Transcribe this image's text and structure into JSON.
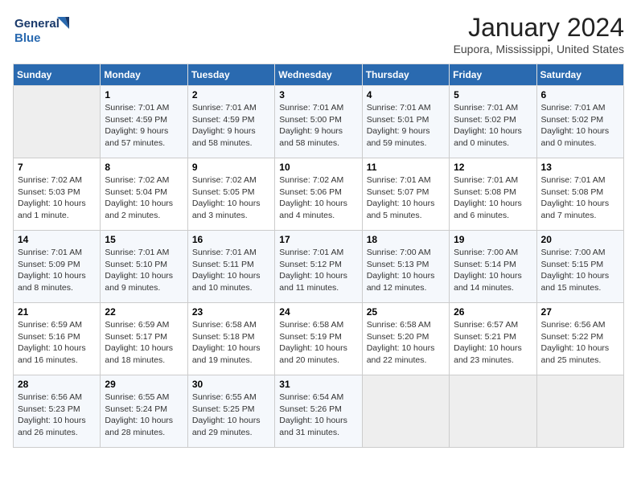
{
  "header": {
    "logo_line1": "General",
    "logo_line2": "Blue",
    "title": "January 2024",
    "subtitle": "Eupora, Mississippi, United States"
  },
  "days_of_week": [
    "Sunday",
    "Monday",
    "Tuesday",
    "Wednesday",
    "Thursday",
    "Friday",
    "Saturday"
  ],
  "weeks": [
    [
      {
        "day": null
      },
      {
        "day": "1",
        "sunrise": "7:01 AM",
        "sunset": "4:59 PM",
        "daylight": "9 hours and 57 minutes."
      },
      {
        "day": "2",
        "sunrise": "7:01 AM",
        "sunset": "4:59 PM",
        "daylight": "9 hours and 58 minutes."
      },
      {
        "day": "3",
        "sunrise": "7:01 AM",
        "sunset": "5:00 PM",
        "daylight": "9 hours and 58 minutes."
      },
      {
        "day": "4",
        "sunrise": "7:01 AM",
        "sunset": "5:01 PM",
        "daylight": "9 hours and 59 minutes."
      },
      {
        "day": "5",
        "sunrise": "7:01 AM",
        "sunset": "5:02 PM",
        "daylight": "10 hours and 0 minutes."
      },
      {
        "day": "6",
        "sunrise": "7:01 AM",
        "sunset": "5:02 PM",
        "daylight": "10 hours and 0 minutes."
      }
    ],
    [
      {
        "day": "7",
        "sunrise": "7:02 AM",
        "sunset": "5:03 PM",
        "daylight": "10 hours and 1 minute."
      },
      {
        "day": "8",
        "sunrise": "7:02 AM",
        "sunset": "5:04 PM",
        "daylight": "10 hours and 2 minutes."
      },
      {
        "day": "9",
        "sunrise": "7:02 AM",
        "sunset": "5:05 PM",
        "daylight": "10 hours and 3 minutes."
      },
      {
        "day": "10",
        "sunrise": "7:02 AM",
        "sunset": "5:06 PM",
        "daylight": "10 hours and 4 minutes."
      },
      {
        "day": "11",
        "sunrise": "7:01 AM",
        "sunset": "5:07 PM",
        "daylight": "10 hours and 5 minutes."
      },
      {
        "day": "12",
        "sunrise": "7:01 AM",
        "sunset": "5:08 PM",
        "daylight": "10 hours and 6 minutes."
      },
      {
        "day": "13",
        "sunrise": "7:01 AM",
        "sunset": "5:08 PM",
        "daylight": "10 hours and 7 minutes."
      }
    ],
    [
      {
        "day": "14",
        "sunrise": "7:01 AM",
        "sunset": "5:09 PM",
        "daylight": "10 hours and 8 minutes."
      },
      {
        "day": "15",
        "sunrise": "7:01 AM",
        "sunset": "5:10 PM",
        "daylight": "10 hours and 9 minutes."
      },
      {
        "day": "16",
        "sunrise": "7:01 AM",
        "sunset": "5:11 PM",
        "daylight": "10 hours and 10 minutes."
      },
      {
        "day": "17",
        "sunrise": "7:01 AM",
        "sunset": "5:12 PM",
        "daylight": "10 hours and 11 minutes."
      },
      {
        "day": "18",
        "sunrise": "7:00 AM",
        "sunset": "5:13 PM",
        "daylight": "10 hours and 12 minutes."
      },
      {
        "day": "19",
        "sunrise": "7:00 AM",
        "sunset": "5:14 PM",
        "daylight": "10 hours and 14 minutes."
      },
      {
        "day": "20",
        "sunrise": "7:00 AM",
        "sunset": "5:15 PM",
        "daylight": "10 hours and 15 minutes."
      }
    ],
    [
      {
        "day": "21",
        "sunrise": "6:59 AM",
        "sunset": "5:16 PM",
        "daylight": "10 hours and 16 minutes."
      },
      {
        "day": "22",
        "sunrise": "6:59 AM",
        "sunset": "5:17 PM",
        "daylight": "10 hours and 18 minutes."
      },
      {
        "day": "23",
        "sunrise": "6:58 AM",
        "sunset": "5:18 PM",
        "daylight": "10 hours and 19 minutes."
      },
      {
        "day": "24",
        "sunrise": "6:58 AM",
        "sunset": "5:19 PM",
        "daylight": "10 hours and 20 minutes."
      },
      {
        "day": "25",
        "sunrise": "6:58 AM",
        "sunset": "5:20 PM",
        "daylight": "10 hours and 22 minutes."
      },
      {
        "day": "26",
        "sunrise": "6:57 AM",
        "sunset": "5:21 PM",
        "daylight": "10 hours and 23 minutes."
      },
      {
        "day": "27",
        "sunrise": "6:56 AM",
        "sunset": "5:22 PM",
        "daylight": "10 hours and 25 minutes."
      }
    ],
    [
      {
        "day": "28",
        "sunrise": "6:56 AM",
        "sunset": "5:23 PM",
        "daylight": "10 hours and 26 minutes."
      },
      {
        "day": "29",
        "sunrise": "6:55 AM",
        "sunset": "5:24 PM",
        "daylight": "10 hours and 28 minutes."
      },
      {
        "day": "30",
        "sunrise": "6:55 AM",
        "sunset": "5:25 PM",
        "daylight": "10 hours and 29 minutes."
      },
      {
        "day": "31",
        "sunrise": "6:54 AM",
        "sunset": "5:26 PM",
        "daylight": "10 hours and 31 minutes."
      },
      {
        "day": null
      },
      {
        "day": null
      },
      {
        "day": null
      }
    ]
  ],
  "labels": {
    "sunrise": "Sunrise:",
    "sunset": "Sunset:",
    "daylight": "Daylight:"
  }
}
